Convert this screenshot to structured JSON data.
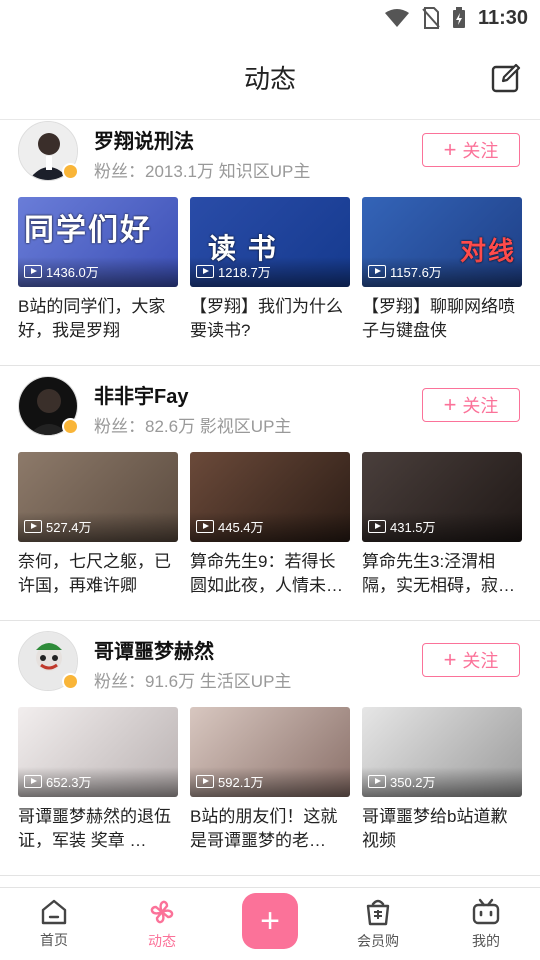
{
  "status": {
    "time": "11:30"
  },
  "header": {
    "title": "动态"
  },
  "cards": [
    {
      "name": "罗翔说刑法",
      "meta": "粉丝：2013.1万 知识区UP主",
      "follow": "关注",
      "videos": [
        {
          "thumb_text": "同学们好",
          "count": "1436.0万",
          "title": "B站的同学们，大家好，我是罗翔"
        },
        {
          "thumb_text": "读 书",
          "count": "1218.7万",
          "title": "【罗翔】我们为什么要读书?"
        },
        {
          "thumb_text": "对线",
          "count": "1157.6万",
          "title": "【罗翔】聊聊网络喷子与键盘侠"
        }
      ]
    },
    {
      "name": "非非宇Fay",
      "meta": "粉丝：82.6万 影视区UP主",
      "follow": "关注",
      "videos": [
        {
          "count": "527.4万",
          "title": "奈何，七尺之躯，已许国，再难许卿"
        },
        {
          "count": "445.4万",
          "title": "算命先生9：若得长圆如此夜，人情未…"
        },
        {
          "count": "431.5万",
          "title": "算命先生3:泾渭相隔，实无相碍，寂…"
        }
      ]
    },
    {
      "name": "哥谭噩梦赫然",
      "meta": "粉丝：91.6万 生活区UP主",
      "follow": "关注",
      "videos": [
        {
          "count": "652.3万",
          "title": "哥谭噩梦赫然的退伍证，军装 奖章 …"
        },
        {
          "count": "592.1万",
          "title": "B站的朋友们！这就是哥谭噩梦的老…"
        },
        {
          "count": "350.2万",
          "title": "哥谭噩梦给b站道歉视频"
        }
      ]
    }
  ],
  "tabbar": {
    "home": "首页",
    "dynamic": "动态",
    "vip": "会员购",
    "me": "我的"
  },
  "colors": {
    "accent": "#fb7299",
    "badge": "#f9b538"
  }
}
